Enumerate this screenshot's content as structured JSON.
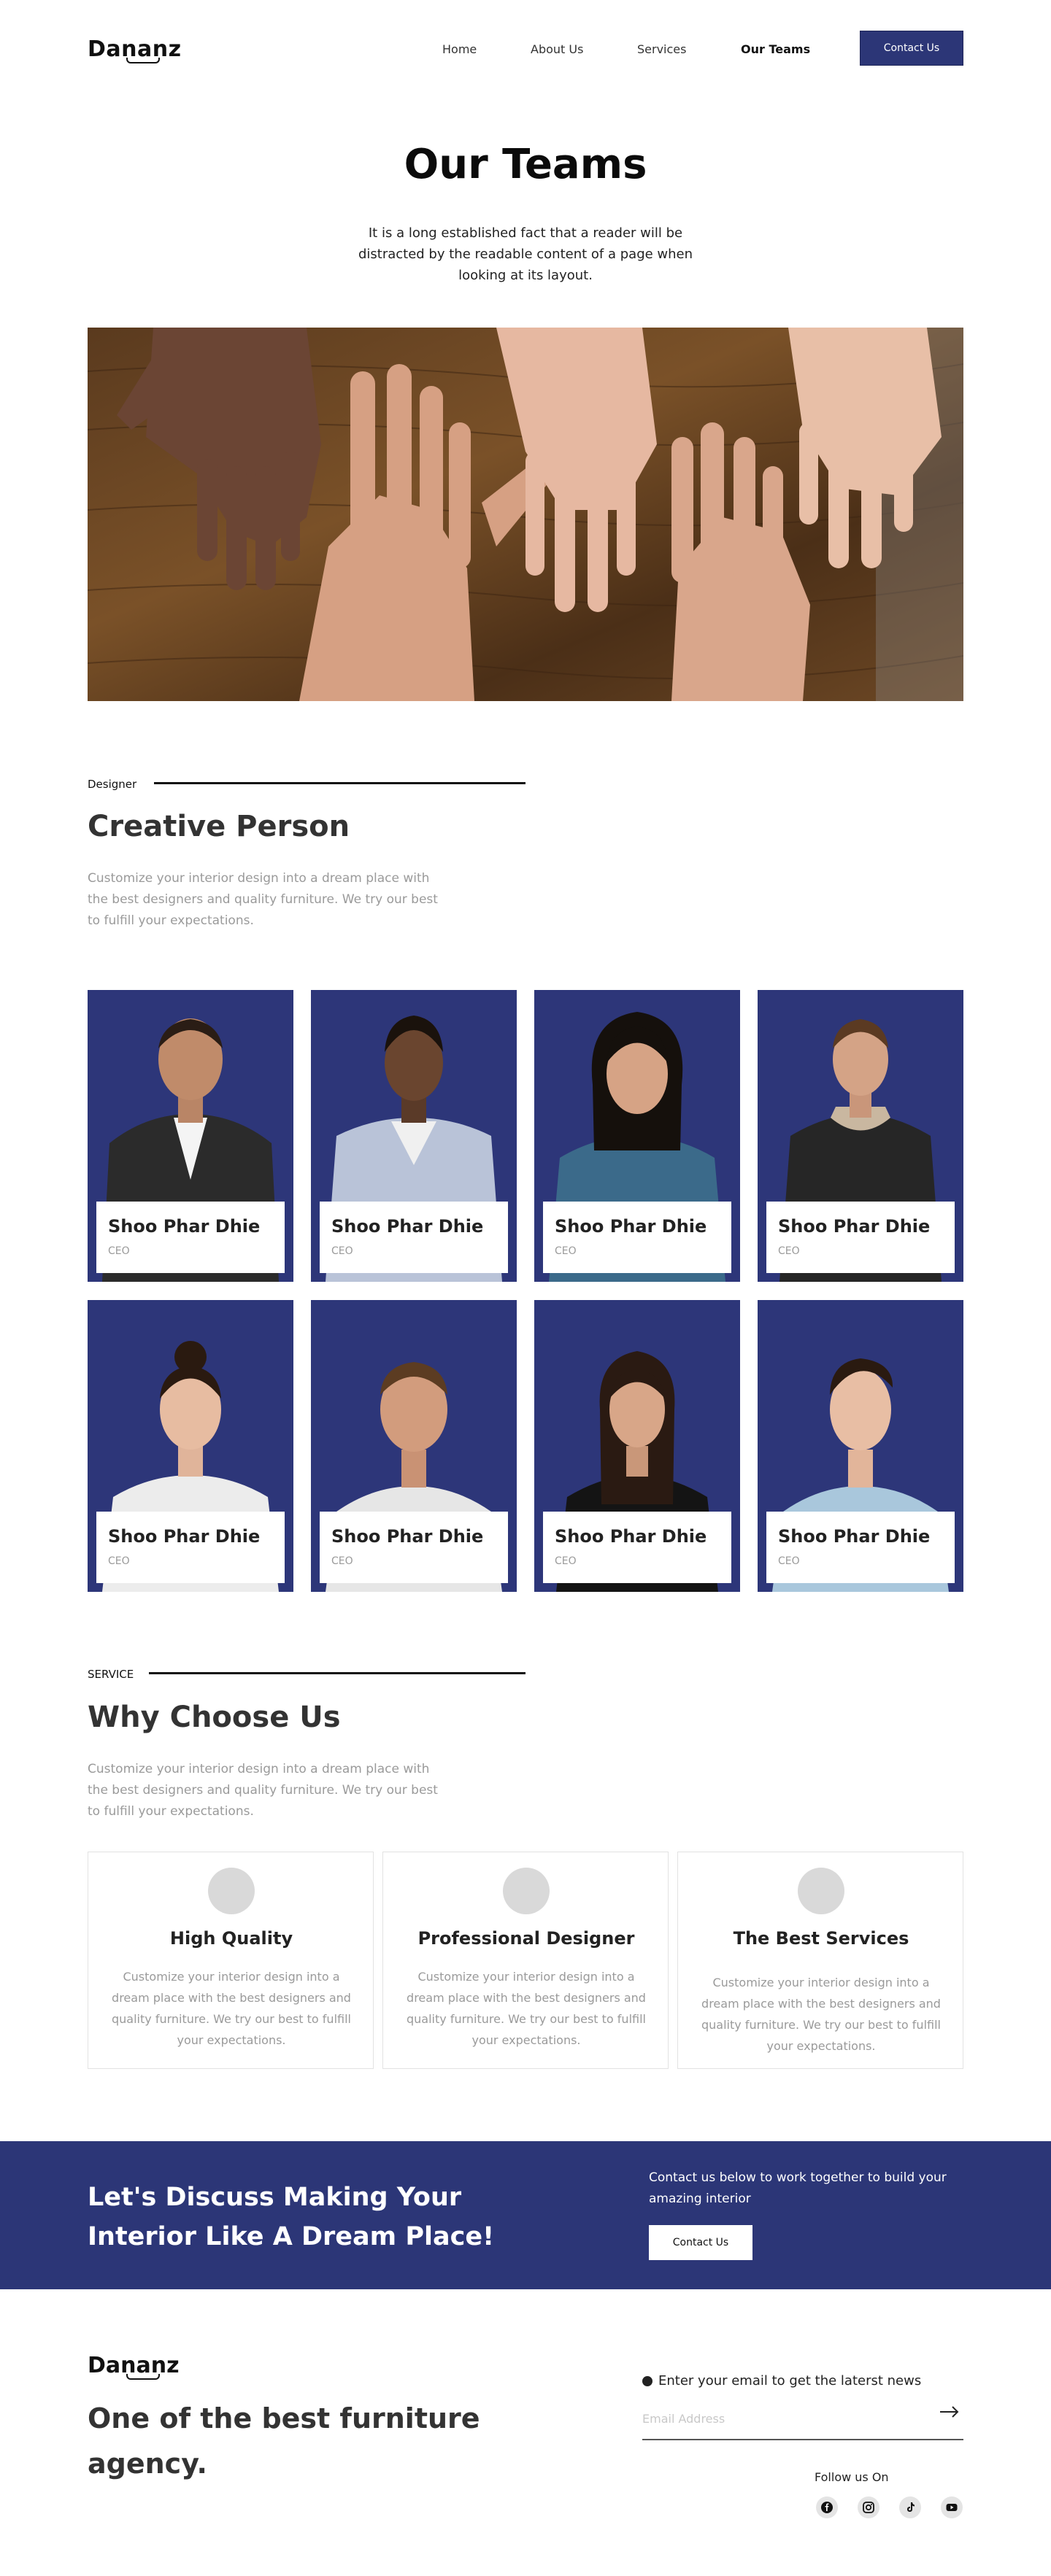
{
  "brand": {
    "logo": "Dananz"
  },
  "nav": {
    "links": [
      {
        "label": "Home"
      },
      {
        "label": "About Us"
      },
      {
        "label": "Services"
      },
      {
        "label": "Our Teams"
      }
    ],
    "contact_button": "Contact Us"
  },
  "hero": {
    "title": "Our Teams",
    "subtitle": "It is a long established fact that a reader will be distracted by the readable content of a page when looking at its layout."
  },
  "team_section": {
    "eyebrow": "Designer",
    "title": "Creative Person",
    "description": "Customize your interior design into a dream place with the best designers and quality furniture. We try our best to fulfill your expectations.",
    "members": [
      {
        "name": "Shoo Phar Dhie",
        "role": "CEO"
      },
      {
        "name": "Shoo Phar Dhie",
        "role": "CEO"
      },
      {
        "name": "Shoo Phar Dhie",
        "role": "CEO"
      },
      {
        "name": "Shoo Phar Dhie",
        "role": "CEO"
      },
      {
        "name": "Shoo Phar Dhie",
        "role": "CEO"
      },
      {
        "name": "Shoo Phar Dhie",
        "role": "CEO"
      },
      {
        "name": "Shoo Phar Dhie",
        "role": "CEO"
      },
      {
        "name": "Shoo Phar Dhie",
        "role": "CEO"
      }
    ]
  },
  "why_section": {
    "eyebrow": "SERVICE",
    "title": "Why Choose Us",
    "description": "Customize your interior design into a dream place with the best designers and quality furniture. We try our best to fulfill your expectations.",
    "features": [
      {
        "title": "High Quality",
        "description": "Customize your interior design into a dream place with the best designers and quality furniture. We try our best to fulfill your expectations."
      },
      {
        "title": "Professional Designer",
        "description": "Customize your interior design into a dream place with the best designers and quality furniture. We try our best to fulfill your expectations."
      },
      {
        "title": "The Best Services",
        "description": "Customize your interior design into a dream place with the best designers and quality furniture. We try our best to fulfill your expectations."
      }
    ]
  },
  "cta": {
    "title": "Let's Discuss Making Your Interior Like A Dream Place!",
    "text": "Contact us below to work together to build your amazing interior",
    "button": "Contact Us"
  },
  "footer": {
    "logo": "Dananz",
    "tagline": "One of the best furniture agency.",
    "newsletter_label": "Enter  your email to get the laterst news",
    "email_placeholder": "Email Address",
    "follow_label": "Follow us On",
    "socials": [
      "facebook-icon",
      "instagram-icon",
      "tiktok-icon",
      "youtube-icon"
    ]
  },
  "colors": {
    "brand": "#2c3677",
    "text_dark": "#222222",
    "text_muted": "#9a9a9a"
  }
}
